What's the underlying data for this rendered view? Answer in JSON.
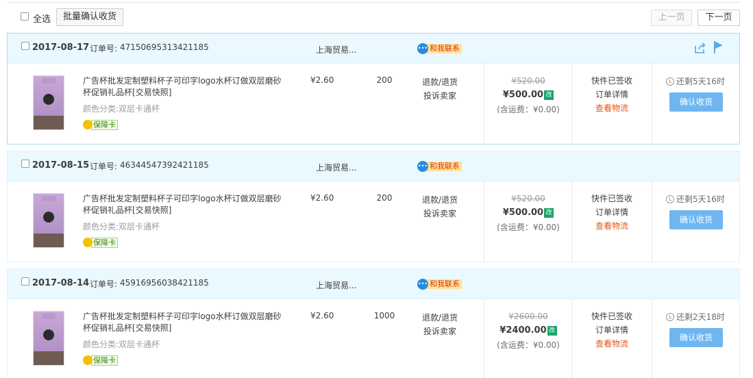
{
  "toolbar": {
    "select_all_label": "全选",
    "batch_confirm_label": "批量确认收货",
    "prev_label": "上一页",
    "next_label": "下一页"
  },
  "order_labels": {
    "order_no_label": "订单号:",
    "contact_label": "和我联系",
    "guarantee_label": "保障卡",
    "sku_prefix": "颜色分类:",
    "modified_badge": "改",
    "refund_label": "退款/退货",
    "complain_label": "投诉卖家",
    "detail_label": "订单详情",
    "logistics_label": "查看物流",
    "confirm_label": "确认收货"
  },
  "orders": [
    {
      "date": "2017-08-17",
      "order_no": "47150695313421185",
      "shop": "上海贸易...",
      "title": "广告杯批发定制塑料杯子可印字logo水杯订做双层磨砂杯促销礼品杯",
      "snapshot": "[交易快照]",
      "sku": "双层卡通杯",
      "unit_price": "¥2.60",
      "quantity": "200",
      "original_total": "¥520.00",
      "actual_total": "¥500.00",
      "shipping": "(含运费：¥0.00)",
      "status": "快件已签收",
      "remaining": "还剩5天16时"
    },
    {
      "date": "2017-08-15",
      "order_no": "46344547392421185",
      "shop": "上海贸易...",
      "title": "广告杯批发定制塑料杯子可印字logo水杯订做双层磨砂杯促销礼品杯",
      "snapshot": "[交易快照]",
      "sku": "双层卡通杯",
      "unit_price": "¥2.60",
      "quantity": "200",
      "original_total": "¥520.00",
      "actual_total": "¥500.00",
      "shipping": "(含运费：¥0.00)",
      "status": "快件已签收",
      "remaining": "还剩5天16时"
    },
    {
      "date": "2017-08-14",
      "order_no": "45916956038421185",
      "shop": "上海贸易...",
      "title": "广告杯批发定制塑料杯子可印字logo水杯订做双层磨砂杯促销礼品杯",
      "snapshot": "[交易快照]",
      "sku": "双层卡通杯",
      "unit_price": "¥2.60",
      "quantity": "1000",
      "original_total": "¥2600.00",
      "actual_total": "¥2400.00",
      "shipping": "(含运费：¥0.00)",
      "status": "快件已签收",
      "remaining": "还剩2天18时"
    }
  ],
  "colors": {
    "header_bg": "#eaf8ff",
    "confirm_button": "#6fb6f0",
    "logistics_link": "#e15613",
    "contact_badge": "#ffe39c"
  }
}
